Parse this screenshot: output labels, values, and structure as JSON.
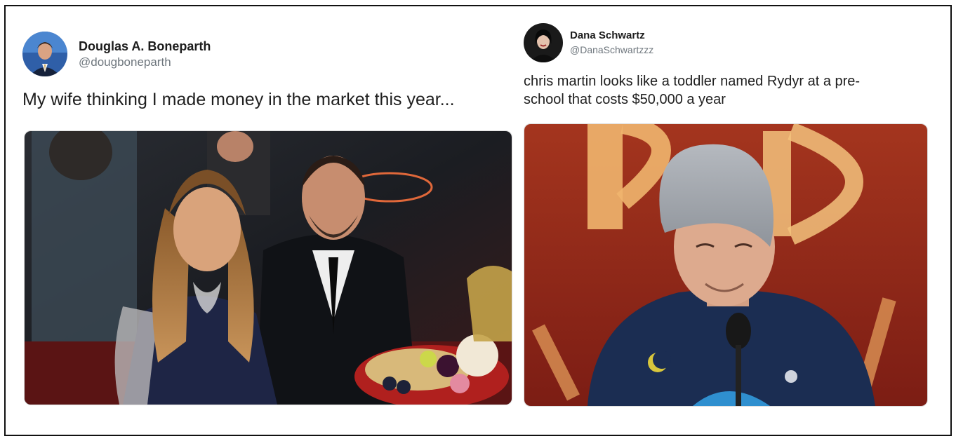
{
  "tweets": [
    {
      "author": {
        "display_name": "Douglas A. Boneparth",
        "handle": "@dougboneparth"
      },
      "text": "My wife thinking I made money in the market this year...",
      "media": {
        "type": "photo"
      }
    },
    {
      "author": {
        "display_name": "Dana Schwartz",
        "handle": "@DanaSchwartzzz"
      },
      "text": "chris martin looks like a toddler named Rydyr at a pre-\nschool that costs $50,000 a year",
      "media": {
        "type": "photo"
      }
    }
  ],
  "colors": {
    "handle": "#6e767d",
    "text": "#1f1f1f",
    "frame_border": "#111111"
  }
}
